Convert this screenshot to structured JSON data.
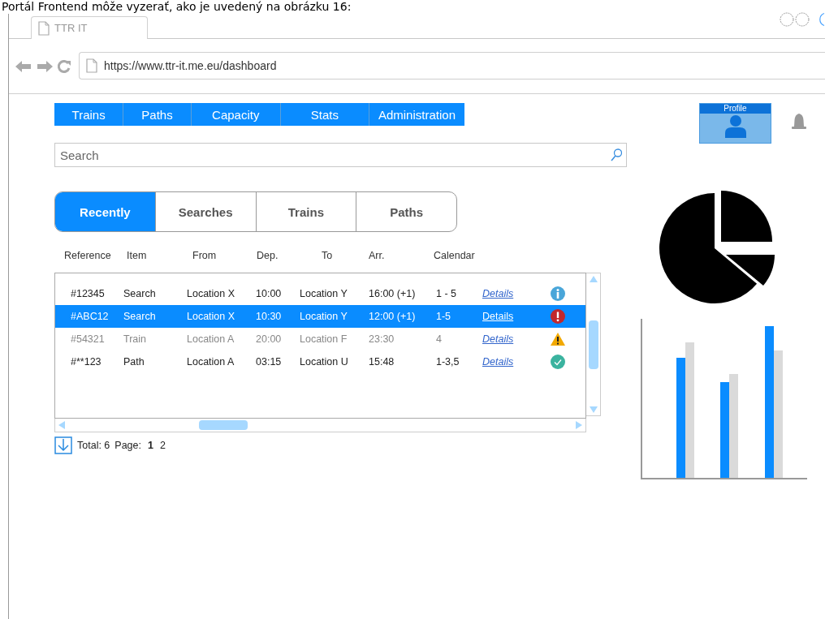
{
  "caption": "Portál Frontend môže vyzerať, ako je uvedený na obrázku 16:",
  "browser": {
    "tab_title": "TTR IT",
    "url": "https://www.ttr-it.me.eu/dashboard"
  },
  "nav_menu": [
    {
      "label": "Trains"
    },
    {
      "label": "Paths"
    },
    {
      "label": "Capacity"
    },
    {
      "label": "Stats"
    },
    {
      "label": "Administration"
    }
  ],
  "search": {
    "placeholder": "Search"
  },
  "profile": {
    "label": "Profile"
  },
  "tabs": [
    {
      "label": "Recently",
      "selected": true
    },
    {
      "label": "Searches",
      "selected": false
    },
    {
      "label": "Trains",
      "selected": false
    },
    {
      "label": "Paths",
      "selected": false
    }
  ],
  "table": {
    "columns": [
      "Reference",
      "Item",
      "From",
      "Dep.",
      "To",
      "Arr.",
      "Calendar"
    ],
    "rows": [
      {
        "cells": [
          "#12345",
          "Search",
          "Location X",
          "10:00",
          "Location Y",
          "16:00 (+1)",
          "1 - 5"
        ],
        "link": "Details",
        "kind": "info",
        "selected": false,
        "dimmed": false
      },
      {
        "cells": [
          "#ABC12",
          "Search",
          "Location X",
          "10:30",
          "Location Y",
          "12:00 (+1)",
          "1-5"
        ],
        "link": "Details",
        "kind": "error",
        "selected": true,
        "dimmed": false
      },
      {
        "cells": [
          "#54321",
          "Train",
          "Location A",
          "20:00",
          "Location F",
          "23:30",
          "4"
        ],
        "link": "Details",
        "kind": "warning",
        "selected": false,
        "dimmed": true
      },
      {
        "cells": [
          "#**123",
          "Path",
          "Location A",
          "03:15",
          "Location U",
          "15:48",
          "1-3,5"
        ],
        "link": "Details",
        "kind": "ok",
        "selected": false,
        "dimmed": false
      }
    ]
  },
  "footer": {
    "total": "Total: 6",
    "page_label": "Page:",
    "pages": [
      {
        "label": "1",
        "selected": true
      },
      {
        "label": "2",
        "selected": false
      }
    ]
  }
}
